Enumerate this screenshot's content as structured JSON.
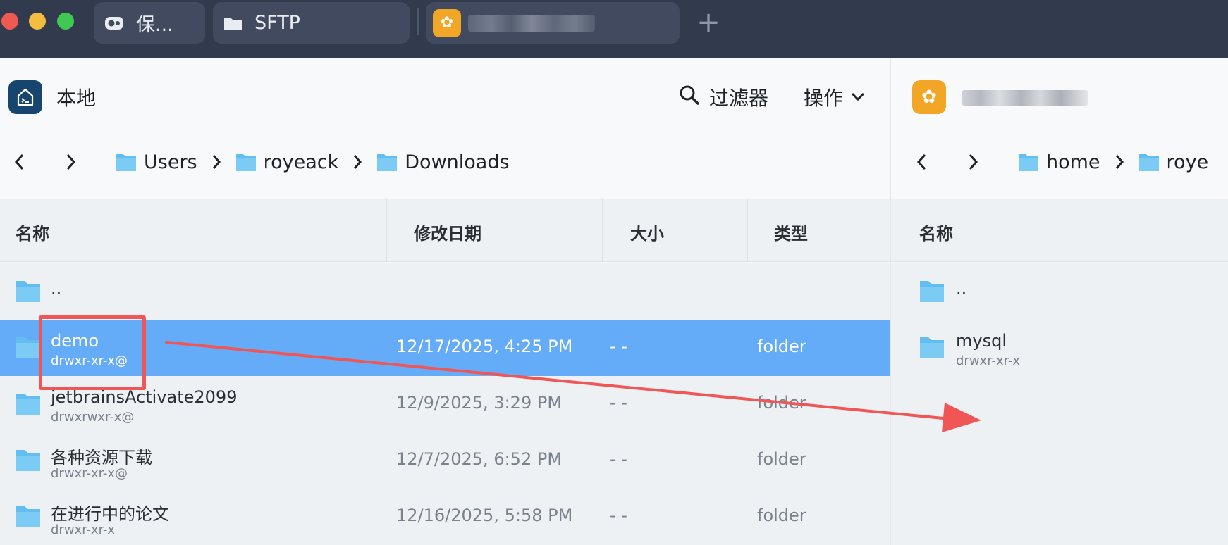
{
  "tabs": [
    {
      "label": "保...",
      "icon": "gamepad-icon"
    },
    {
      "label": "SFTP",
      "icon": "folder-icon"
    },
    {
      "label": "",
      "icon": "gear-flower-icon"
    }
  ],
  "left": {
    "title": "本地",
    "filter_label": "过滤器",
    "actions_label": "操作",
    "breadcrumb": [
      "Users",
      "royeack",
      "Downloads"
    ],
    "columns": [
      "名称",
      "修改日期",
      "大小",
      "类型"
    ],
    "rows": [
      {
        "name": "..",
        "perm": "",
        "date": "",
        "size": "",
        "type": ""
      },
      {
        "name": "demo",
        "perm": "drwxr-xr-x@",
        "date": "12/17/2025, 4:25 PM",
        "size": "- -",
        "type": "folder",
        "selected": true
      },
      {
        "name": "jetbrainsActivate2099",
        "perm": "drwxrwxr-x@",
        "date": "12/9/2025, 3:29 PM",
        "size": "- -",
        "type": "folder"
      },
      {
        "name": "各种资源下载",
        "perm": "drwxr-xr-x@",
        "date": "12/7/2025, 6:52 PM",
        "size": "- -",
        "type": "folder"
      },
      {
        "name": "在进行中的论文",
        "perm": "drwxr-xr-x",
        "date": "12/16/2025, 5:58 PM",
        "size": "- -",
        "type": "folder"
      }
    ]
  },
  "right": {
    "breadcrumb": [
      "home",
      "roye"
    ],
    "columns": [
      "名称"
    ],
    "rows": [
      {
        "name": "..",
        "perm": ""
      },
      {
        "name": "mysql",
        "perm": "drwxr-xr-x"
      }
    ]
  },
  "colors": {
    "titlebar": "#323a4e",
    "tab": "#414a5e",
    "selected_row": "#64abf8",
    "folder": "#62bdf0",
    "annotation": "#f05656",
    "remote_badge": "#f2a626",
    "local_badge": "#17456e"
  }
}
